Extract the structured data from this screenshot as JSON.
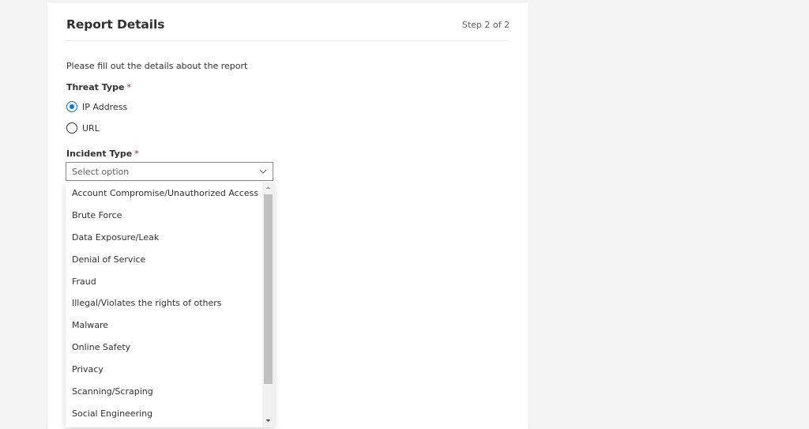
{
  "header": {
    "title": "Report Details",
    "step": "Step 2 of 2"
  },
  "form": {
    "intro": "Please fill out the details about the report",
    "threat_type": {
      "label": "Threat Type",
      "required_marker": "*",
      "options": [
        {
          "label": "IP Address",
          "checked": true
        },
        {
          "label": "URL",
          "checked": false
        }
      ]
    },
    "incident_type": {
      "label": "Incident Type",
      "required_marker": "*",
      "placeholder": "Select option",
      "options": [
        "Account Compromise/Unauthorized Access",
        "Brute Force",
        "Data Exposure/Leak",
        "Denial of Service",
        "Fraud",
        "Illegal/Violates the rights of others",
        "Malware",
        "Online Safety",
        "Privacy",
        "Scanning/Scraping",
        "Social Engineering"
      ]
    }
  },
  "icons": {
    "dropdown_chevron": "chevron-down-icon",
    "scroll_up": "triangle-up-icon",
    "scroll_down": "triangle-down-icon"
  },
  "colors": {
    "accent": "#0078d4",
    "required": "#a4262c",
    "text": "#323130",
    "secondary_text": "#605e5c",
    "border": "#8a8886"
  }
}
